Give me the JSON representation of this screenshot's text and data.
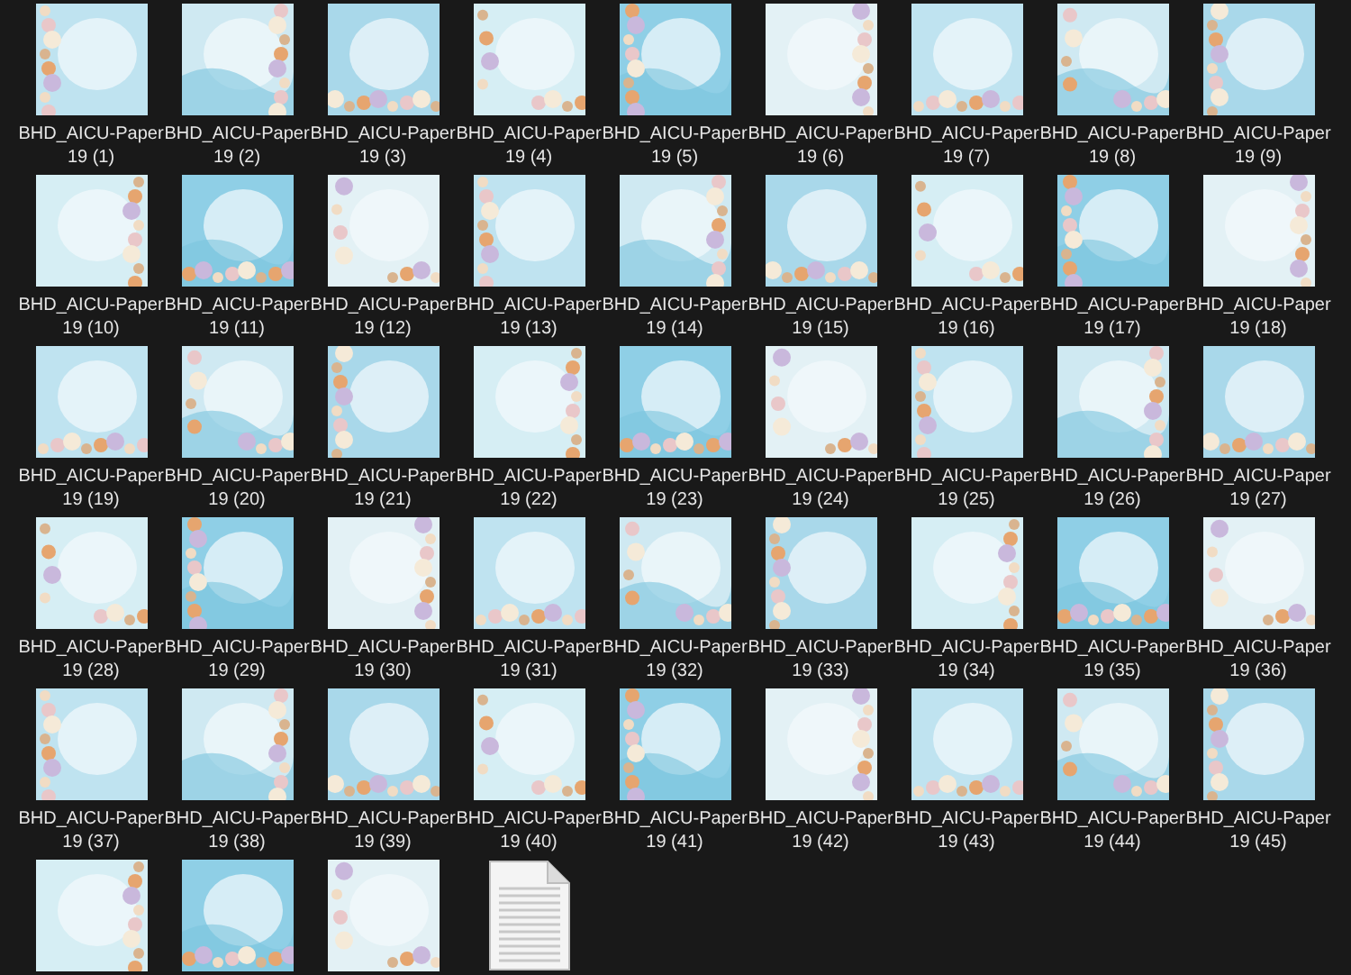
{
  "items": [
    {
      "kind": "picture",
      "label": "BHD_AICU-Paper 19 (1)"
    },
    {
      "kind": "picture",
      "label": "BHD_AICU-Paper 19 (2)"
    },
    {
      "kind": "picture",
      "label": "BHD_AICU-Paper 19 (3)"
    },
    {
      "kind": "picture",
      "label": "BHD_AICU-Paper 19 (4)"
    },
    {
      "kind": "picture",
      "label": "BHD_AICU-Paper 19 (5)"
    },
    {
      "kind": "picture",
      "label": "BHD_AICU-Paper 19 (6)"
    },
    {
      "kind": "picture",
      "label": "BHD_AICU-Paper 19 (7)"
    },
    {
      "kind": "picture",
      "label": "BHD_AICU-Paper 19 (8)"
    },
    {
      "kind": "picture",
      "label": "BHD_AICU-Paper 19 (9)"
    },
    {
      "kind": "picture",
      "label": "BHD_AICU-Paper 19 (10)"
    },
    {
      "kind": "picture",
      "label": "BHD_AICU-Paper 19 (11)"
    },
    {
      "kind": "picture",
      "label": "BHD_AICU-Paper 19 (12)"
    },
    {
      "kind": "picture",
      "label": "BHD_AICU-Paper 19 (13)"
    },
    {
      "kind": "picture",
      "label": "BHD_AICU-Paper 19 (14)"
    },
    {
      "kind": "picture",
      "label": "BHD_AICU-Paper 19 (15)"
    },
    {
      "kind": "picture",
      "label": "BHD_AICU-Paper 19 (16)"
    },
    {
      "kind": "picture",
      "label": "BHD_AICU-Paper 19 (17)"
    },
    {
      "kind": "picture",
      "label": "BHD_AICU-Paper 19 (18)"
    },
    {
      "kind": "picture",
      "label": "BHD_AICU-Paper 19 (19)"
    },
    {
      "kind": "picture",
      "label": "BHD_AICU-Paper 19 (20)"
    },
    {
      "kind": "picture",
      "label": "BHD_AICU-Paper 19 (21)"
    },
    {
      "kind": "picture",
      "label": "BHD_AICU-Paper 19 (22)"
    },
    {
      "kind": "picture",
      "label": "BHD_AICU-Paper 19 (23)"
    },
    {
      "kind": "picture",
      "label": "BHD_AICU-Paper 19 (24)"
    },
    {
      "kind": "picture",
      "label": "BHD_AICU-Paper 19 (25)"
    },
    {
      "kind": "picture",
      "label": "BHD_AICU-Paper 19 (26)"
    },
    {
      "kind": "picture",
      "label": "BHD_AICU-Paper 19 (27)"
    },
    {
      "kind": "picture",
      "label": "BHD_AICU-Paper 19 (28)"
    },
    {
      "kind": "picture",
      "label": "BHD_AICU-Paper 19 (29)"
    },
    {
      "kind": "picture",
      "label": "BHD_AICU-Paper 19 (30)"
    },
    {
      "kind": "picture",
      "label": "BHD_AICU-Paper 19 (31)"
    },
    {
      "kind": "picture",
      "label": "BHD_AICU-Paper 19 (32)"
    },
    {
      "kind": "picture",
      "label": "BHD_AICU-Paper 19 (33)"
    },
    {
      "kind": "picture",
      "label": "BHD_AICU-Paper 19 (34)"
    },
    {
      "kind": "picture",
      "label": "BHD_AICU-Paper 19 (35)"
    },
    {
      "kind": "picture",
      "label": "BHD_AICU-Paper 19 (36)"
    },
    {
      "kind": "picture",
      "label": "BHD_AICU-Paper 19 (37)"
    },
    {
      "kind": "picture",
      "label": "BHD_AICU-Paper 19 (38)"
    },
    {
      "kind": "picture",
      "label": "BHD_AICU-Paper 19 (39)"
    },
    {
      "kind": "picture",
      "label": "BHD_AICU-Paper 19 (40)"
    },
    {
      "kind": "picture",
      "label": "BHD_AICU-Paper 19 (41)"
    },
    {
      "kind": "picture",
      "label": "BHD_AICU-Paper 19 (42)"
    },
    {
      "kind": "picture",
      "label": "BHD_AICU-Paper 19 (43)"
    },
    {
      "kind": "picture",
      "label": "BHD_AICU-Paper 19 (44)"
    },
    {
      "kind": "picture",
      "label": "BHD_AICU-Paper 19 (45)"
    },
    {
      "kind": "picture"
    },
    {
      "kind": "picture"
    },
    {
      "kind": "picture"
    },
    {
      "kind": "file"
    }
  ]
}
